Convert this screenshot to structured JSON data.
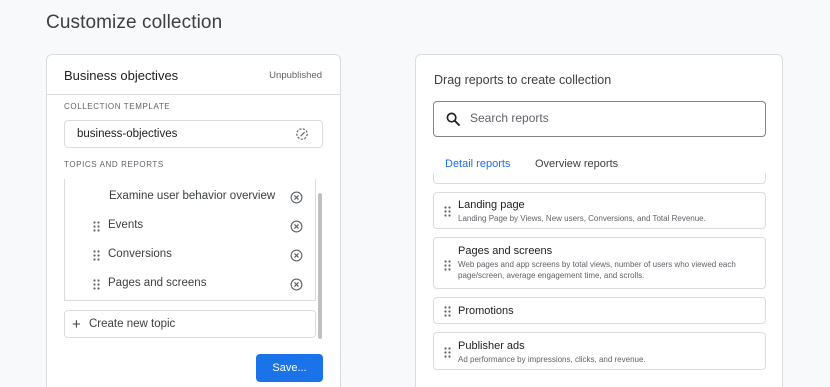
{
  "page": {
    "title": "Customize collection"
  },
  "collection": {
    "title": "Business objectives",
    "status": "Unpublished",
    "template_label": "COLLECTION TEMPLATE",
    "template_value": "business-objectives",
    "topics_label": "TOPICS AND REPORTS",
    "items": [
      {
        "label": "Examine user behavior overview"
      },
      {
        "label": "Events"
      },
      {
        "label": "Conversions"
      },
      {
        "label": "Pages and screens"
      }
    ],
    "create_topic_label": "Create new topic",
    "save_label": "Save..."
  },
  "reports_panel": {
    "title": "Drag reports to create collection",
    "search_placeholder": "Search reports",
    "tabs": [
      {
        "label": "Detail reports",
        "active": true
      },
      {
        "label": "Overview reports",
        "active": false
      }
    ],
    "cards": [
      {
        "title": "Landing page",
        "description": "Landing Page by Views, New users, Conversions, and Total Revenue."
      },
      {
        "title": "Pages and screens",
        "description": "Web pages and app screens by total views, number of users who viewed each page/screen, average engagement time, and scrolls."
      },
      {
        "title": "Promotions",
        "description": ""
      },
      {
        "title": "Publisher ads",
        "description": "Ad performance by impressions, clicks, and revenue."
      }
    ]
  },
  "colors": {
    "accent": "#1a73e8",
    "border": "#dadce0",
    "muted_text": "#5f6368"
  },
  "icons": {
    "search": "search-icon",
    "remove": "close-circle-icon",
    "drag": "drag-handle-icon",
    "template_edit": "edit-settings-icon",
    "plus": "plus-icon"
  }
}
